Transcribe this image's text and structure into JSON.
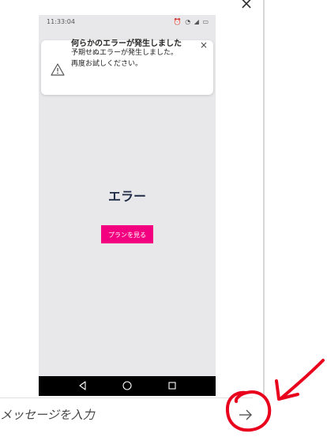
{
  "status_bar": {
    "time": "11:33:04",
    "icons": "⏰ ◔ ◢ ▭"
  },
  "toast": {
    "title": "何らかのエラーが発生しました",
    "body_line1": "予期せぬエラーが発生しました。",
    "body_line2": "再度お試しください。",
    "close_glyph": "×",
    "icon": "warning-triangle-icon"
  },
  "main": {
    "error_heading": "エラー",
    "plan_button_label": "プランを見る"
  },
  "nav_bar": {
    "back_icon": "back-triangle-icon",
    "home_icon": "home-circle-icon",
    "recents_icon": "recents-square-icon"
  },
  "composer": {
    "placeholder": "メッセージを入力",
    "send_icon": "arrow-right-icon"
  },
  "window": {
    "close_glyph": "×"
  },
  "colors": {
    "accent": "#f2007f",
    "annotation": "#e8001c",
    "heading": "#1f2a44",
    "phone_bg": "#e8e8ea"
  }
}
